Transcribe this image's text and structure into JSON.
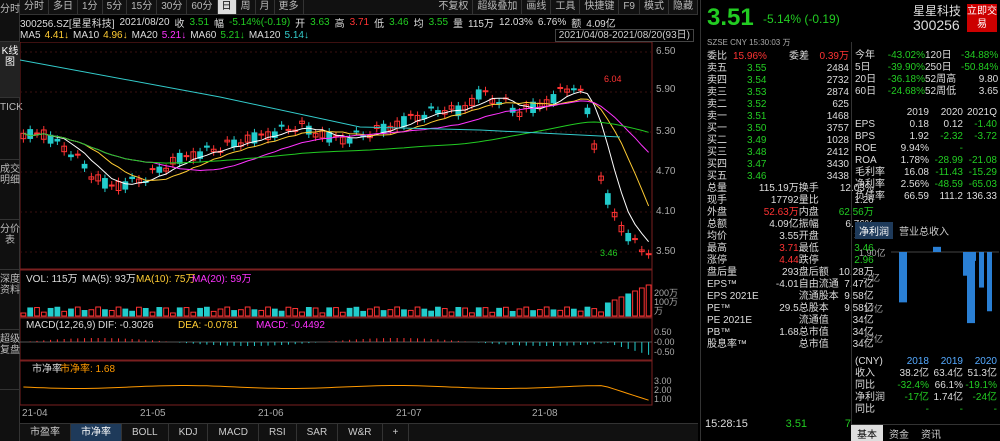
{
  "left_tabs": [
    "分时",
    "K线图",
    "TICK",
    "成交明细",
    "分价表",
    "深度资料",
    "超级复盘"
  ],
  "toolbar": {
    "periods": [
      "分时",
      "多日",
      "1分",
      "5分",
      "15分",
      "30分",
      "60分",
      "日",
      "周",
      "月",
      "更多"
    ],
    "selected": "日",
    "right": [
      "不复权",
      "超级叠加",
      "画线",
      "工具",
      "快捷键",
      "F9",
      "模式",
      "隐藏"
    ]
  },
  "info": {
    "code": "300256.SZ[星星科技]",
    "date": "2021/08/20",
    "close_label": "收",
    "close": "3.51",
    "change_label": "幅",
    "change": "-5.14%(-0.19)",
    "open_label": "开",
    "open": "3.63",
    "high_label": "高",
    "high": "3.71",
    "low_label": "低",
    "low": "3.46",
    "avg_label": "均",
    "avg": "3.55",
    "vol_label": "量",
    "vol": "115万",
    "turnover": "12.03%",
    "amplitude": "6.76%",
    "amount_label": "额",
    "amount": "4.09亿"
  },
  "ma": {
    "ma5": "MA5",
    "ma5v": "4.41↓",
    "ma10": "MA10",
    "ma10v": "4.96↓",
    "ma20": "MA20",
    "ma20v": "5.21↓",
    "ma60": "MA60",
    "ma60v": "5.21↓",
    "ma120": "MA120",
    "ma120v": "5.14↓",
    "range": "2021/04/08-2021/08/20(93日)"
  },
  "price_axis": [
    "6.50",
    "5.90",
    "5.30",
    "4.70",
    "4.10",
    "3.50"
  ],
  "price_marks": {
    "high": "6.04",
    "low": "3.46"
  },
  "vol": {
    "title": "VOL: 115万",
    "ma5": "MA(5): 93万",
    "ma10": "MA(10): 75万",
    "ma20": "MA(20): 59万",
    "axis": [
      "200万",
      "100万",
      "万"
    ]
  },
  "macd": {
    "title": "MACD(12,26,9)",
    "dif": "DIF: -0.3026",
    "dea": "DEA: -0.0781",
    "macd": "MACD: -0.4492",
    "axis": [
      "0.50",
      "-0.00",
      "-0.50"
    ]
  },
  "pb": {
    "title": "市净率",
    "value": "市净率: 1.68",
    "axis": [
      "3.00",
      "2.00",
      "1.00"
    ]
  },
  "xaxis": [
    "21-04",
    "21-05",
    "21-06",
    "21-07",
    "21-08"
  ],
  "bottom_tabs": [
    "市盈率",
    "市净率",
    "BOLL",
    "KDJ",
    "MACD",
    "RSI",
    "SAR",
    "W&R"
  ],
  "bottom_selected": "市净率",
  "quote": {
    "price": "3.51",
    "change": "-5.14% (-0.19)",
    "name": "星星科技",
    "code": "300256",
    "btn": "立即交易",
    "sub": "SZSE CNY 15:30:03 万",
    "ratio_label": "委比",
    "ratio": "15.96%",
    "diff_label": "委差",
    "diff": "0.39万",
    "asks": [
      [
        "卖五",
        "3.55",
        "2484"
      ],
      [
        "卖四",
        "3.54",
        "2732"
      ],
      [
        "卖三",
        "3.53",
        "2874"
      ],
      [
        "卖二",
        "3.52",
        "625"
      ],
      [
        "卖一",
        "3.51",
        "1468"
      ]
    ],
    "bids": [
      [
        "买一",
        "3.50",
        "3757"
      ],
      [
        "买二",
        "3.49",
        "1028"
      ],
      [
        "买三",
        "3.48",
        "2412"
      ],
      [
        "买四",
        "3.47",
        "3430"
      ],
      [
        "买五",
        "3.46",
        "3438"
      ]
    ],
    "stats": [
      [
        "总量",
        "115.19万",
        "换手",
        "12.03%"
      ],
      [
        "现手",
        "17792",
        "量比",
        "1.26"
      ],
      [
        "外盘",
        "52.63万",
        "内盘",
        "62.56万"
      ],
      [
        "总额",
        "4.09亿",
        "振幅",
        "6.76%"
      ],
      [
        "均价",
        "3.55",
        "开盘",
        "3.63"
      ],
      [
        "最高",
        "3.71",
        "最低",
        "3.46"
      ],
      [
        "涨停",
        "4.44",
        "跌停",
        "2.96"
      ],
      [
        "盘后量",
        "293",
        "盘后额",
        "10.28万"
      ],
      [
        "EPS™",
        "-4.01",
        "自由流通",
        "7.47亿"
      ],
      [
        "EPS 2021E",
        "",
        "流通股本",
        "9.58亿"
      ],
      [
        "PE™",
        "29.5",
        "总股本",
        "9.58亿"
      ],
      [
        "PE 2021E",
        "",
        "流通值",
        "34亿"
      ],
      [
        "PB™",
        "1.68",
        "总市值",
        "34亿"
      ],
      [
        "股息率™",
        "",
        "总市值",
        "34亿"
      ]
    ],
    "time": "15:28:15",
    "tick_price": "3.51",
    "tick_vol": "7"
  },
  "perf": [
    [
      "今年",
      "-43.02%",
      "120日",
      "-34.88%"
    ],
    [
      "5日",
      "-39.90%",
      "250日",
      "-50.84%"
    ],
    [
      "20日",
      "-36.18%",
      "52周高",
      "9.80"
    ],
    [
      "60日",
      "-24.68%",
      "52周低",
      "3.65"
    ]
  ],
  "fin_header": [
    "",
    "2019",
    "2020",
    "2021Q"
  ],
  "fin": [
    [
      "EPS",
      "0.18",
      "0.12",
      "-1.40"
    ],
    [
      "BPS",
      "1.92",
      "-2.32",
      "-3.72"
    ],
    [
      "ROE",
      "9.94%",
      "-",
      ""
    ],
    [
      "ROA",
      "1.78%",
      "-28.99",
      "-21.08"
    ],
    [
      "毛利率",
      "16.08",
      "-11.43",
      "-15.29"
    ],
    [
      "净利率",
      "2.56%",
      "-48.59",
      "-65.03"
    ],
    [
      "负债率",
      "66.59",
      "111.2",
      "136.33"
    ]
  ],
  "fin_tabs": [
    "净利润",
    "营业总收入"
  ],
  "profit_axis": [
    "1.90亿",
    "-7亿",
    "-17亿",
    "-27亿"
  ],
  "chart_data": {
    "type": "bar",
    "categories": [
      "2018",
      "2019",
      "2020"
    ],
    "series": [
      {
        "name": "收入",
        "values": [
          38.2,
          63.4,
          51.3
        ]
      },
      {
        "name": "净利润",
        "values": [
          -17,
          1.74,
          -24
        ]
      }
    ],
    "ylabel": "亿"
  },
  "rev": {
    "header": [
      "(CNY)",
      "2018",
      "2019",
      "2020"
    ],
    "rows": [
      [
        "收入",
        "38.2亿",
        "63.4亿",
        "51.3亿"
      ],
      [
        "同比",
        "-32.4%",
        "66.1%",
        "-19.1%"
      ],
      [
        "净利润",
        "-17亿",
        "1.74亿",
        "-24亿"
      ],
      [
        "同比",
        "-",
        "-",
        "-"
      ]
    ]
  },
  "rp_tabs": [
    "基本",
    "资金",
    "资讯"
  ],
  "colors": {
    "up": "#ff3333",
    "down": "#22cc22",
    "bg": "#000000"
  }
}
